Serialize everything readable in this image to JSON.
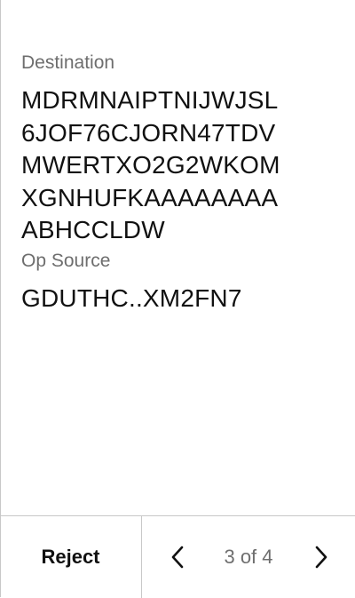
{
  "details": {
    "destination_label": "Destination",
    "destination_lines": [
      "MDRMNAIPTNIJWJSL",
      "6JOF76CJORN47TDV",
      "MWERTXO2G2WKOM",
      "XGNHUFKAAAAAAAA",
      "ABHCCLDW"
    ],
    "op_source_label": "Op Source",
    "op_source_value": "GDUTHC..XM2FN7"
  },
  "footer": {
    "reject_label": "Reject",
    "pager_text": "3 of 4",
    "prev_icon": "chevron-left-icon",
    "next_icon": "chevron-right-icon"
  }
}
